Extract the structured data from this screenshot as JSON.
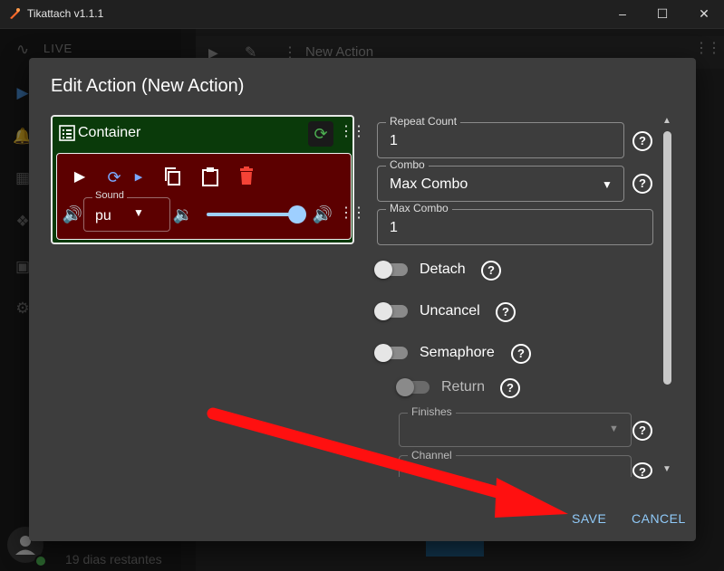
{
  "window": {
    "title": "Tikattach v1.1.1"
  },
  "background": {
    "live_label": "LIVE",
    "action_title": "New Action",
    "days_remaining": "19 dias restantes"
  },
  "dialog": {
    "title": "Edit Action (New Action)",
    "container_label": "Container",
    "sound": {
      "label": "Sound",
      "value": "pu"
    },
    "volume_level": 1.0,
    "fields": {
      "repeat_count": {
        "label": "Repeat Count",
        "value": "1"
      },
      "combo": {
        "label": "Combo",
        "value": "Max Combo"
      },
      "max_combo": {
        "label": "Max Combo",
        "value": "1"
      },
      "finishes": {
        "label": "Finishes",
        "value": ""
      },
      "channel": {
        "label": "Channel",
        "value": ""
      }
    },
    "toggles": {
      "detach": {
        "label": "Detach",
        "on": false
      },
      "uncancel": {
        "label": "Uncancel",
        "on": false
      },
      "semaphore": {
        "label": "Semaphore",
        "on": false
      },
      "return": {
        "label": "Return",
        "on": false,
        "disabled": true
      }
    },
    "help_glyph": "?",
    "save_label": "SAVE",
    "cancel_label": "CANCEL"
  },
  "colors": {
    "container_bg": "#0a3a0a",
    "sound_card_bg": "#5c0000",
    "accent_blue": "#90caf9",
    "delete_red": "#f44336",
    "arrow_red": "#ff1010"
  }
}
